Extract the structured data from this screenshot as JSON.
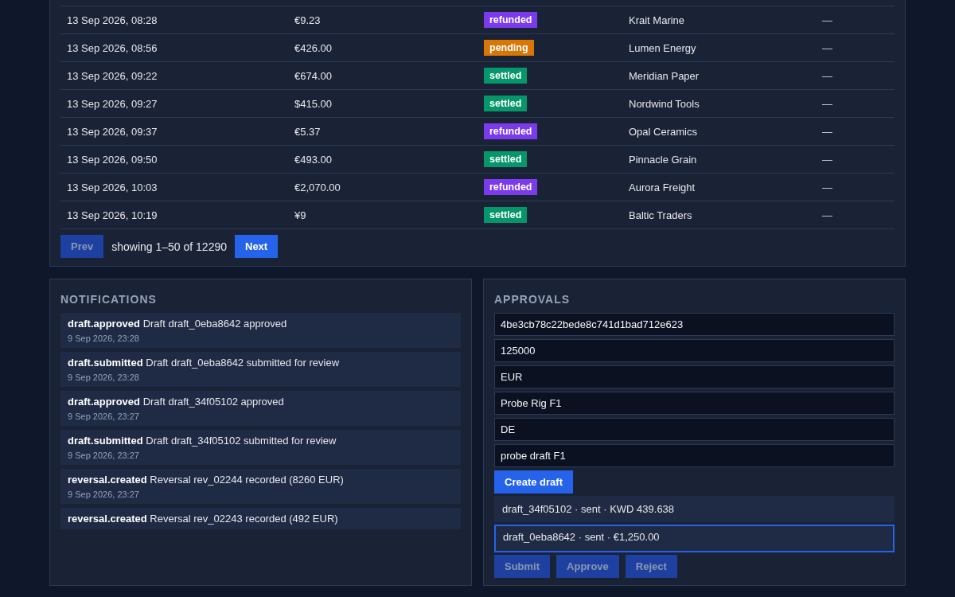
{
  "transactions": {
    "rows": [
      {
        "time": "13 Sep 2026, 08:28",
        "amount": "€9.23",
        "status": {
          "label": "refunded",
          "color": "#7c3aed"
        },
        "counterparty": "Krait Marine",
        "column_5": "—"
      },
      {
        "time": "13 Sep 2026, 08:56",
        "amount": "€426.00",
        "status": {
          "label": "pending",
          "color": "#d97706"
        },
        "counterparty": "Lumen Energy",
        "column_5": "—"
      },
      {
        "time": "13 Sep 2026, 09:22",
        "amount": "€674.00",
        "status": {
          "label": "settled",
          "color": "#059669"
        },
        "counterparty": "Meridian Paper",
        "column_5": "—"
      },
      {
        "time": "13 Sep 2026, 09:27",
        "amount": "$415.00",
        "status": {
          "label": "settled",
          "color": "#059669"
        },
        "counterparty": "Nordwind Tools",
        "column_5": "—"
      },
      {
        "time": "13 Sep 2026, 09:37",
        "amount": "€5.37",
        "status": {
          "label": "refunded",
          "color": "#7c3aed"
        },
        "counterparty": "Opal Ceramics",
        "column_5": "—"
      },
      {
        "time": "13 Sep 2026, 09:50",
        "amount": "€493.00",
        "status": {
          "label": "settled",
          "color": "#059669"
        },
        "counterparty": "Pinnacle Grain",
        "column_5": "—"
      },
      {
        "time": "13 Sep 2026, 10:03",
        "amount": "€2,070.00",
        "status": {
          "label": "refunded",
          "color": "#7c3aed"
        },
        "counterparty": "Aurora Freight",
        "column_5": "—"
      },
      {
        "time": "13 Sep 2026, 10:19",
        "amount": "¥9",
        "status": {
          "label": "settled",
          "color": "#059669"
        },
        "counterparty": "Baltic Traders",
        "column_5": "—"
      }
    ],
    "pagination": {
      "prev": {
        "label": "Prev",
        "disabled": true
      },
      "summary": "showing 1–50 of 12290",
      "next": {
        "label": "Next",
        "disabled": false
      }
    }
  },
  "notifications": {
    "title": "NOTIFICATIONS",
    "items": [
      {
        "text": "**draft.approved** Draft draft_0eba8642 approved",
        "time": "9 Sep 2026, 23:28"
      },
      {
        "text": "**draft.submitted** Draft draft_0eba8642 submitted for review",
        "time": "9 Sep 2026, 23:28"
      },
      {
        "text": "**draft.approved** Draft draft_34f05102 approved",
        "time": "9 Sep 2026, 23:27"
      },
      {
        "text": "**draft.submitted** Draft draft_34f05102 submitted for review",
        "time": "9 Sep 2026, 23:27"
      },
      {
        "text": "**reversal.created** Reversal rev_02244 recorded (8260 EUR)",
        "time": "9 Sep 2026, 23:27"
      },
      {
        "text": "**reversal.created** Reversal rev_02243 recorded (492 EUR)"
      }
    ]
  },
  "approvals": {
    "title": "APPROVALS",
    "fields": [
      {
        "value": "4be3cb78c22bede8c741d1bad712e623"
      },
      {
        "value": "125000"
      },
      {
        "value": "EUR"
      },
      {
        "value": "Probe Rig F1"
      },
      {
        "value": "DE"
      },
      {
        "value": "probe draft F1"
      }
    ],
    "create_button": {
      "label": "Create draft",
      "disabled": false
    },
    "drafts": [
      {
        "label": "draft_34f05102 · sent · KWD 439.638",
        "selected": false
      },
      {
        "label": "draft_0eba8642 · sent · €1,250.00",
        "selected": true
      }
    ],
    "actions": [
      {
        "label": "Submit",
        "disabled": true
      },
      {
        "label": "Approve",
        "disabled": true
      },
      {
        "label": "Reject",
        "disabled": true
      }
    ]
  }
}
